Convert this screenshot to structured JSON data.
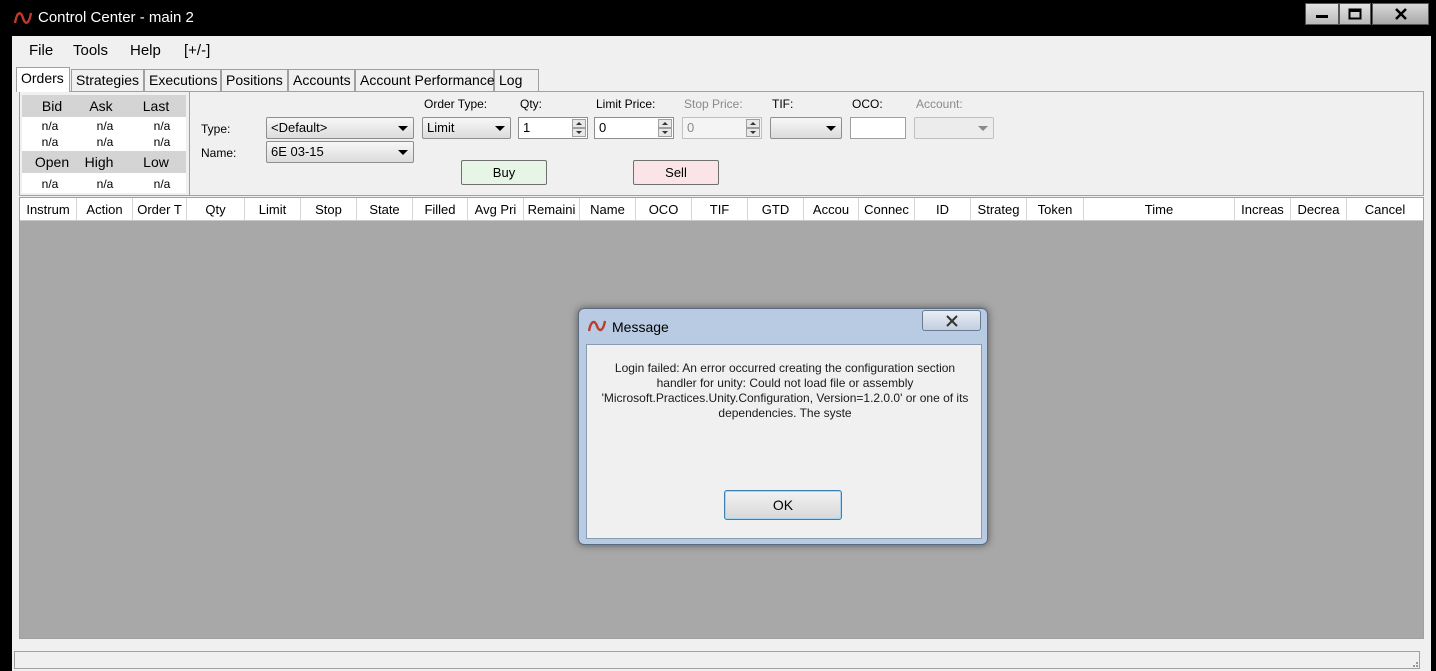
{
  "window": {
    "title": "Control Center - main 2"
  },
  "menu": [
    "File",
    "Tools",
    "Help",
    "[+/-]"
  ],
  "tabs": [
    "Orders",
    "Strategies",
    "Executions",
    "Positions",
    "Accounts",
    "Account Performance",
    "Log"
  ],
  "quote": {
    "headers1": [
      "Bid",
      "Ask",
      "Last"
    ],
    "row1": [
      "n/a",
      "n/a",
      "n/a"
    ],
    "row2": [
      "n/a",
      "n/a",
      "n/a"
    ],
    "headers2": [
      "Open",
      "High",
      "Low"
    ],
    "row3": [
      "n/a",
      "n/a",
      "n/a"
    ]
  },
  "order_form": {
    "type_label": "Type:",
    "type_value": "<Default>",
    "name_label": "Name:",
    "name_value": "6E 03-15",
    "order_type_label": "Order Type:",
    "order_type_value": "Limit",
    "qty_label": "Qty:",
    "qty_value": "1",
    "limit_price_label": "Limit Price:",
    "limit_price_value": "0",
    "stop_price_label": "Stop Price:",
    "stop_price_value": "0",
    "tif_label": "TIF:",
    "tif_value": "",
    "oco_label": "OCO:",
    "oco_value": "",
    "account_label": "Account:",
    "account_value": "",
    "buy_label": "Buy",
    "sell_label": "Sell",
    "buy_color": "#e6f5e6",
    "sell_color": "#fbe4e8"
  },
  "grid": {
    "columns": [
      "Instrum",
      "Action",
      "Order T",
      "Qty",
      "Limit",
      "Stop",
      "State",
      "Filled",
      "Avg Pri",
      "Remaini",
      "Name",
      "OCO",
      "TIF",
      "GTD",
      "Accou",
      "Connec",
      "ID",
      "Strateg",
      "Token",
      "Time",
      "Increas",
      "Decrea",
      "Cancel"
    ],
    "background": "#a8a8a8"
  },
  "dialog": {
    "title": "Message",
    "message": "Login failed: An error occurred creating the configuration section handler for unity: Could not load file or assembly 'Microsoft.Practices.Unity.Configuration, Version=1.2.0.0' or one of its dependencies. The syste",
    "ok_label": "OK"
  },
  "icons": {
    "app": "ninjatrader-logo-icon",
    "minimize": "minimize-icon",
    "maximize": "maximize-icon",
    "close": "close-icon",
    "dropdown": "chevron-down-icon"
  }
}
